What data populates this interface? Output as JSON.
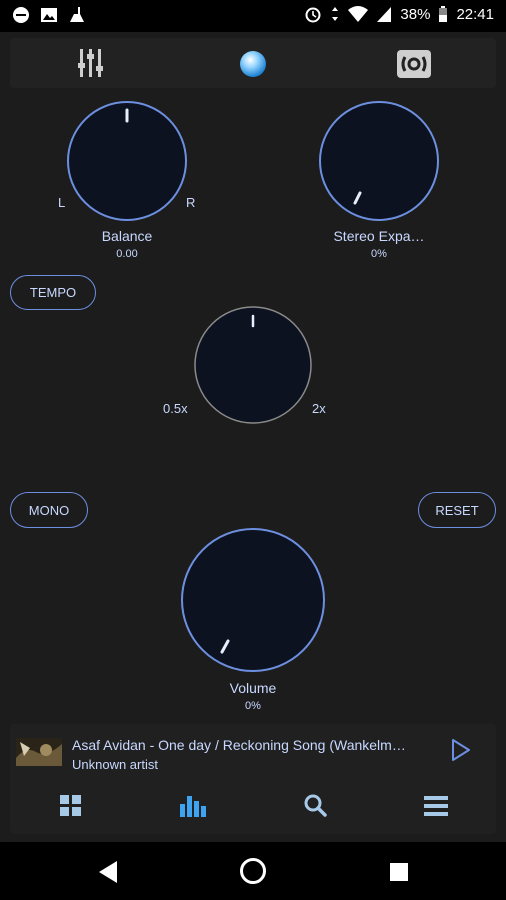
{
  "status_bar": {
    "battery": "38%",
    "time": "22:41"
  },
  "knobs": {
    "balance": {
      "label": "Balance",
      "value": "0.00",
      "left_label": "L",
      "right_label": "R"
    },
    "stereo": {
      "label": "Stereo Expa…",
      "value": "0%"
    },
    "tempo": {
      "left_label": "0.5x",
      "right_label": "2x"
    },
    "volume": {
      "label": "Volume",
      "value": "0%"
    }
  },
  "buttons": {
    "tempo": "TEMPO",
    "mono": "MONO",
    "reset": "RESET"
  },
  "player": {
    "title": "Asaf Avidan - One day / Reckoning Song (Wankelm…",
    "artist": "Unknown artist"
  },
  "colors": {
    "accent": "#6d8fe0",
    "text": "#c8d8ff",
    "knob_fill": "#0c1220",
    "background": "#1c1c1c"
  }
}
